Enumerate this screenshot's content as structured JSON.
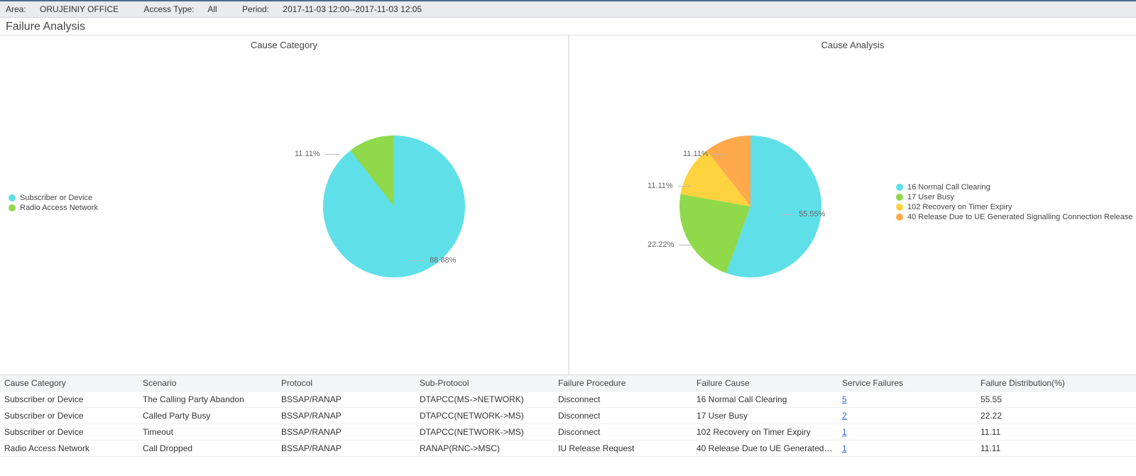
{
  "header": {
    "area_label": "Area:",
    "area_value": "ORUJEINIY OFFICE",
    "access_label": "Access Type:",
    "access_value": "All",
    "period_label": "Period:",
    "period_value": "2017-11-03 12:00--2017-11-03 12:05"
  },
  "page_title": "Failure Analysis",
  "colors": {
    "c1": "#5fe0e8",
    "c2": "#8fd94a",
    "c3": "#ffd23f",
    "c4": "#ffa94d"
  },
  "chart_data": [
    {
      "type": "pie",
      "title": "Cause Category",
      "series": [
        {
          "name": "Subscriber or Device",
          "value": 88.88,
          "label": "88.88%",
          "color": "#5fe0e8"
        },
        {
          "name": "Radio Access Network",
          "value": 11.11,
          "label": "11.11%",
          "color": "#8fd94a"
        }
      ],
      "legend_position": "left"
    },
    {
      "type": "pie",
      "title": "Cause Analysis",
      "series": [
        {
          "name": "16 Normal Call Clearing",
          "value": 55.55,
          "label": "55.55%",
          "color": "#5fe0e8"
        },
        {
          "name": "17 User Busy",
          "value": 22.22,
          "label": "22.22%",
          "color": "#8fd94a"
        },
        {
          "name": "102 Recovery on Timer Expiry",
          "value": 11.11,
          "label": "11.11%",
          "color": "#ffd23f"
        },
        {
          "name": "40 Release Due to UE Generated Signalling Connection Release",
          "value": 11.11,
          "label": "11.11%",
          "color": "#ffa94d"
        }
      ],
      "legend_position": "right"
    }
  ],
  "table": {
    "columns": [
      "Cause Category",
      "Scenario",
      "Protocol",
      "Sub-Protocol",
      "Failure Procedure",
      "Failure Cause",
      "Service Failures",
      "Failure Distribution(%)"
    ],
    "rows": [
      {
        "cause_category": "Subscriber or Device",
        "scenario": "The Calling Party Abandon",
        "protocol": "BSSAP/RANAP",
        "sub_protocol": "DTAPCC(MS->NETWORK)",
        "failure_procedure": "Disconnect",
        "failure_cause": "16 Normal Call Clearing",
        "service_failures": "5",
        "failure_distribution": "55.55"
      },
      {
        "cause_category": "Subscriber or Device",
        "scenario": "Called Party Busy",
        "protocol": "BSSAP/RANAP",
        "sub_protocol": "DTAPCC(NETWORK->MS)",
        "failure_procedure": "Disconnect",
        "failure_cause": "17 User Busy",
        "service_failures": "2",
        "failure_distribution": "22.22"
      },
      {
        "cause_category": "Subscriber or Device",
        "scenario": "Timeout",
        "protocol": "BSSAP/RANAP",
        "sub_protocol": "DTAPCC(NETWORK->MS)",
        "failure_procedure": "Disconnect",
        "failure_cause": "102 Recovery on Timer Expiry",
        "service_failures": "1",
        "failure_distribution": "11.11"
      },
      {
        "cause_category": "Radio Access Network",
        "scenario": "Call Dropped",
        "protocol": "BSSAP/RANAP",
        "sub_protocol": "RANAP(RNC->MSC)",
        "failure_procedure": "IU Release Request",
        "failure_cause": "40 Release Due to UE Generated Sign...",
        "service_failures": "1",
        "failure_distribution": "11.11"
      }
    ]
  }
}
